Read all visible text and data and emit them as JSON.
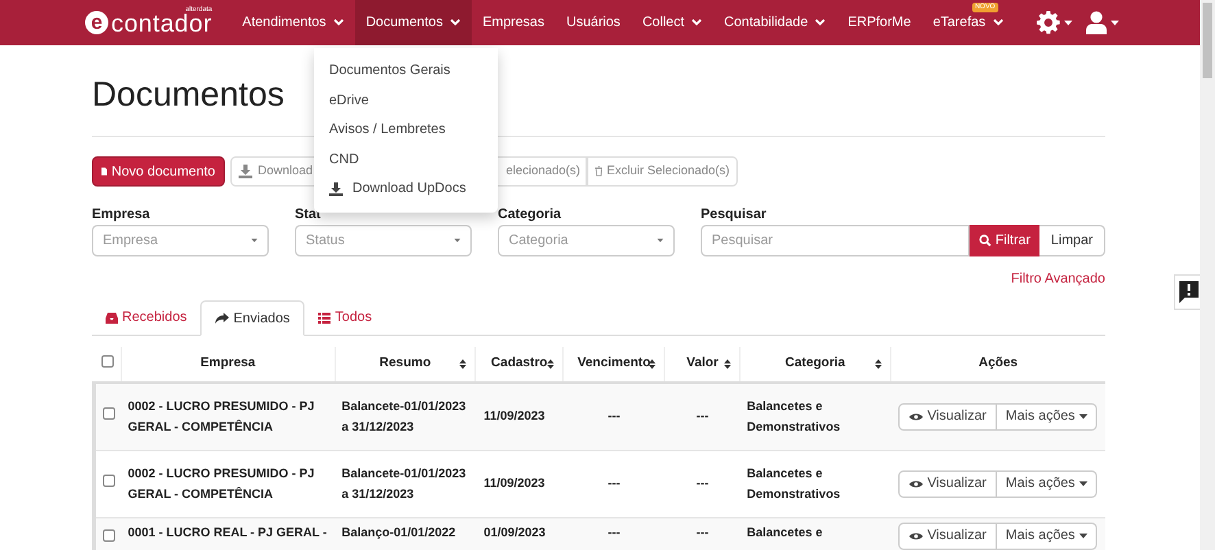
{
  "nav": {
    "logo_letter": "e",
    "logo_text": "contador",
    "logo_tag": "alterdata",
    "items": [
      {
        "label": "Atendimentos",
        "caret": true,
        "selected": false
      },
      {
        "label": "Documentos",
        "caret": true,
        "selected": true
      },
      {
        "label": "Empresas",
        "caret": false,
        "selected": false
      },
      {
        "label": "Usuários",
        "caret": false,
        "selected": false
      },
      {
        "label": "Collect",
        "caret": true,
        "selected": false
      },
      {
        "label": "Contabilidade",
        "caret": true,
        "selected": false
      },
      {
        "label": "ERPforMe",
        "caret": false,
        "selected": false
      },
      {
        "label": "eTarefas",
        "caret": true,
        "selected": false,
        "badge": "NOVO"
      }
    ]
  },
  "dropdown": {
    "items": [
      {
        "label": "Documentos Gerais",
        "kind": "plain"
      },
      {
        "label": "eDrive",
        "kind": "plain"
      },
      {
        "label": "Avisos / Lembretes",
        "kind": "plain"
      },
      {
        "label": "CND",
        "kind": "plain"
      },
      {
        "label": "Download UpDocs",
        "kind": "download"
      }
    ]
  },
  "page_title": "Documentos",
  "toolbar": [
    {
      "label": "Novo documento",
      "kind": "new"
    },
    {
      "label": "Download",
      "kind": "download"
    },
    {
      "label": "elecionado(s)",
      "kind": "covered"
    },
    {
      "label": "Excluir Selecionado(s)",
      "kind": "delete"
    }
  ],
  "filters": [
    {
      "label": "Empresa",
      "placeholder": "Empresa"
    },
    {
      "label": "Stat",
      "placeholder": "Status"
    },
    {
      "label": "Categoria",
      "placeholder": "Categoria"
    }
  ],
  "search": {
    "label": "Pesquisar",
    "placeholder": "Pesquisar",
    "filter_button": "Filtrar",
    "clear_button": "Limpar",
    "advanced_link": "Filtro Avançado"
  },
  "tabs": [
    {
      "label": "Recebidos",
      "kind": "inbox",
      "selected": false
    },
    {
      "label": "Enviados",
      "kind": "share",
      "selected": true
    },
    {
      "label": "Todos",
      "kind": "list",
      "selected": false
    }
  ],
  "table": {
    "select_all_checked": false,
    "columns": [
      {
        "label": "Empresa",
        "sortable": false
      },
      {
        "label": "Resumo",
        "sortable": true
      },
      {
        "label": "Cadastro",
        "sortable": true
      },
      {
        "label": "Vencimento",
        "sortable": true
      },
      {
        "label": "Valor",
        "sortable": true
      },
      {
        "label": "Categoria",
        "sortable": true
      },
      {
        "label": "Ações",
        "sortable": false
      }
    ],
    "rows": [
      {
        "checked": false,
        "empresa": "0002 - LUCRO PRESUMIDO - PJ GERAL - COMPETÊNCIA",
        "resumo": "Balancete-01/01/2023 a 31/12/2023",
        "cadastro": "11/09/2023",
        "vencimento": "---",
        "valor": "---",
        "categoria": "Balancetes e Demonstrativos",
        "view_button": "Visualizar",
        "more_button": "Mais ações"
      },
      {
        "checked": false,
        "empresa": "0002 - LUCRO PRESUMIDO - PJ GERAL - COMPETÊNCIA",
        "resumo": "Balancete-01/01/2023 a 31/12/2023",
        "cadastro": "11/09/2023",
        "vencimento": "---",
        "valor": "---",
        "categoria": "Balancetes e Demonstrativos",
        "view_button": "Visualizar",
        "more_button": "Mais ações"
      },
      {
        "checked": false,
        "empresa": "0001 - LUCRO REAL - PJ GERAL -",
        "resumo": "Balanço-01/01/2022",
        "cadastro": "01/09/2023",
        "vencimento": "---",
        "valor": "---",
        "categoria": "Balancetes e",
        "view_button": "Visualizar",
        "more_button": "Mais ações"
      }
    ]
  }
}
